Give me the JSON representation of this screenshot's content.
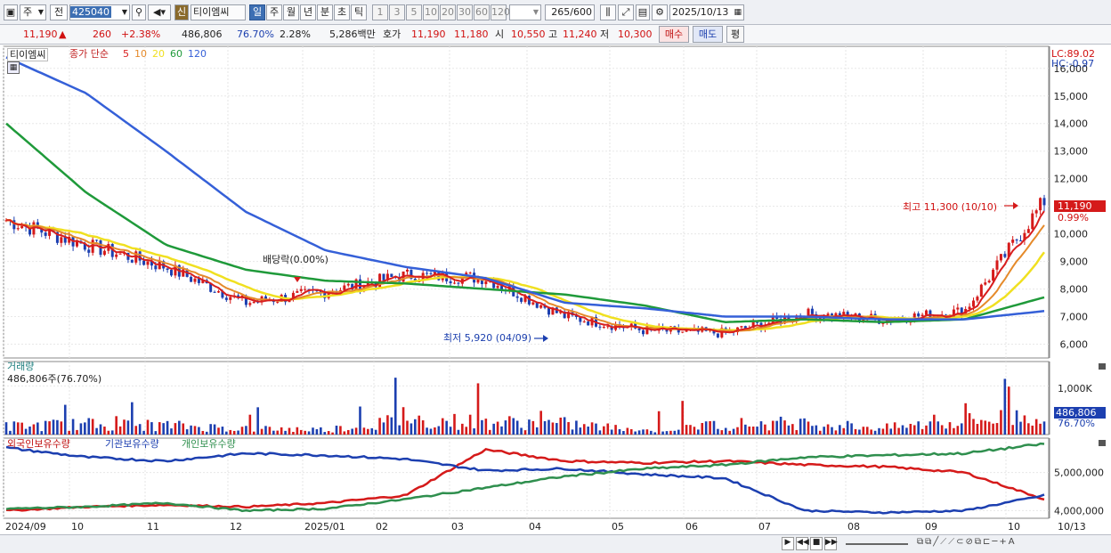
{
  "toolbar": {
    "market": "주",
    "prefix": "전",
    "code": "425040",
    "name_badge": "신",
    "name": "티이엠씨",
    "periods": [
      "일",
      "주",
      "월",
      "년",
      "분",
      "초",
      "틱"
    ],
    "active_period": "일",
    "intervals": [
      "1",
      "3",
      "5",
      "10",
      "20",
      "30",
      "60",
      "120"
    ],
    "count": "265",
    "count_max": "/600",
    "date": "2025/10/13"
  },
  "quote": {
    "price": "11,190",
    "arrow": "▲",
    "change": "260",
    "change_pct": "+2.38%",
    "volume": "486,806",
    "vol_ratio": "76.70%",
    "turnover": "2.28%",
    "amount": "5,286백만",
    "ask_label": "호가",
    "ask": "11,190",
    "bid": "11,180",
    "open_label": "시",
    "open": "10,550",
    "high_label": "고",
    "high": "11,240",
    "low_label": "저",
    "low": "10,300",
    "buy": "매수",
    "sell": "매도",
    "avg": "평"
  },
  "price_pane": {
    "stock_label": "티이엠씨",
    "ma_label": "종가 단순",
    "ma_periods": [
      "5",
      "10",
      "20",
      "60",
      "120"
    ],
    "lc": "LC:89.02",
    "hc": "HC:-0.97",
    "high_note": "최고 11,300 (10/10)",
    "low_note": "최저 5,920 (04/09)",
    "event_note": "배당락(0.00%)",
    "last_price": "11,190",
    "last_pct": "0.99%",
    "ticks": [
      "16,000",
      "15,000",
      "14,000",
      "13,000",
      "12,000",
      "11,000",
      "10,000",
      "9,000",
      "8,000",
      "7,000",
      "6,000"
    ]
  },
  "volume_pane": {
    "title": "거래량",
    "subtitle": "486,806주(76.70%)",
    "tick": "1,000K",
    "last": "486,806",
    "last_pct": "76.70%"
  },
  "holding_pane": {
    "series": [
      "외국인보유수량",
      "기관보유수량",
      "개인보유수량"
    ],
    "ticks": [
      "5,000,000",
      "4,000,000"
    ]
  },
  "xaxis": [
    "2024/09",
    "10",
    "11",
    "12",
    "2025/01",
    "02",
    "03",
    "04",
    "05",
    "06",
    "07",
    "08",
    "09",
    "10",
    "10/13"
  ],
  "colors": {
    "up": "#d51a1a",
    "down": "#1c3fb0",
    "ma5": "#d81e1e",
    "ma10": "#e58a2a",
    "ma20": "#f0e020",
    "ma60": "#1f9a3a",
    "ma120": "#3560d8",
    "inst": "#2f8f4e"
  },
  "chart_data": [
    {
      "type": "line",
      "title": "티이엠씨",
      "ylabel": "",
      "ylim": [
        5500,
        16800
      ],
      "x": [
        "2024/09",
        "2024/10",
        "2024/11",
        "2024/12",
        "2025/01",
        "2025/02",
        "2025/03",
        "2025/04",
        "2025/05",
        "2025/06",
        "2025/07",
        "2025/08",
        "2025/09",
        "2025/10"
      ],
      "series": [
        {
          "name": "종가",
          "values": [
            10500,
            9600,
            8800,
            7500,
            7900,
            8500,
            8400,
            7000,
            6500,
            6400,
            7100,
            6900,
            7200,
            11190
          ]
        },
        {
          "name": "120",
          "values": [
            16400,
            15100,
            13000,
            10800,
            9400,
            8800,
            8400,
            7500,
            7300,
            7000,
            7000,
            6900,
            6900,
            7200
          ]
        },
        {
          "name": "60",
          "values": [
            14000,
            11500,
            9600,
            8700,
            8300,
            8200,
            8000,
            7800,
            7400,
            6800,
            6900,
            6800,
            6900,
            7700
          ]
        }
      ],
      "annotations": [
        "최고 11,300 (10/10)",
        "최저 5,920 (04/09)",
        "배당락(0.00%)"
      ]
    },
    {
      "type": "bar",
      "title": "거래량",
      "ylabel": "",
      "ylim": [
        0,
        1500
      ],
      "categories": [
        "2024/09",
        "2024/10",
        "2024/11",
        "2024/12",
        "2025/01",
        "2025/02",
        "2025/03",
        "2025/04",
        "2025/05",
        "2025/06",
        "2025/07",
        "2025/08",
        "2025/09",
        "2025/10"
      ],
      "values": [
        200,
        250,
        220,
        150,
        120,
        350,
        300,
        260,
        100,
        250,
        280,
        160,
        320,
        487
      ]
    },
    {
      "type": "line",
      "title": "보유수량",
      "ylabel": "",
      "ylim": [
        3800000,
        5900000
      ],
      "x": [
        "2024/09",
        "2024/10",
        "2024/11",
        "2024/12",
        "2025/01",
        "2025/02",
        "2025/03",
        "2025/04",
        "2025/05",
        "2025/06",
        "2025/07",
        "2025/08",
        "2025/09",
        "2025/10"
      ],
      "series": [
        {
          "name": "외국인보유수량",
          "values": [
            4000000,
            4100000,
            4150000,
            4100000,
            4200000,
            4400000,
            5600000,
            5300000,
            5250000,
            5300000,
            5200000,
            5150000,
            5000000,
            4300000
          ]
        },
        {
          "name": "기관보유수량",
          "values": [
            5650000,
            5400000,
            5300000,
            5500000,
            5450000,
            5350000,
            5050000,
            5100000,
            4950000,
            4850000,
            4000000,
            3950000,
            4000000,
            4400000
          ]
        },
        {
          "name": "개인보유수량",
          "values": [
            4050000,
            4100000,
            4200000,
            4000000,
            4050000,
            4300000,
            4600000,
            4900000,
            5100000,
            5200000,
            5400000,
            5450000,
            5500000,
            5750000
          ]
        }
      ]
    }
  ]
}
